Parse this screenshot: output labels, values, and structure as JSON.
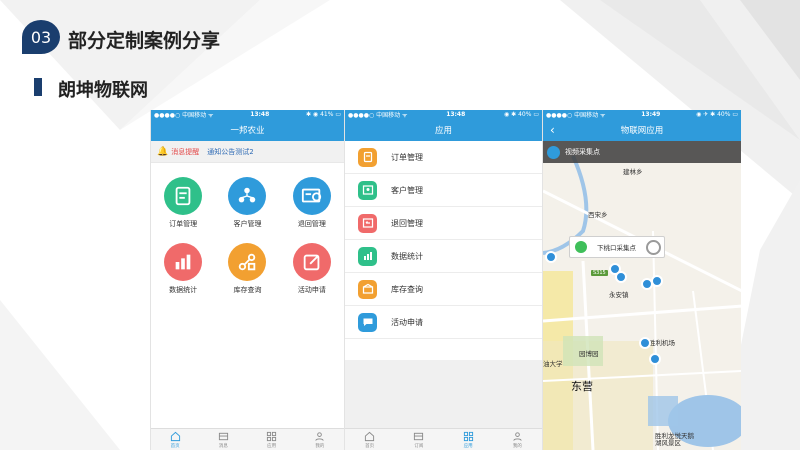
{
  "slide": {
    "section_number": "03",
    "section_title": "部分定制案例分享",
    "subtitle": "朗坤物联网"
  },
  "phone1": {
    "status": {
      "carrier": "●●●●○ 中国移动 ᯤ",
      "time": "13:48",
      "battery": "✱ ◉ 41% ▭"
    },
    "title": "一邦农业",
    "notice": {
      "label": "消息提醒",
      "text": "通知公告测试2"
    },
    "grid": [
      {
        "label": "订单管理",
        "icon": "order-icon",
        "color": "#2fc08a"
      },
      {
        "label": "客户管理",
        "icon": "customer-icon",
        "color": "#2f9bdb"
      },
      {
        "label": "退回管理",
        "icon": "return-icon",
        "color": "#2f9bdb"
      },
      {
        "label": "数据统计",
        "icon": "chart-icon",
        "color": "#f06a6a"
      },
      {
        "label": "库存查询",
        "icon": "inventory-icon",
        "color": "#f2a031"
      },
      {
        "label": "活动申请",
        "icon": "edit-icon",
        "color": "#f06a6a"
      }
    ],
    "tabs": [
      {
        "label": "首页",
        "icon": "home-icon",
        "active": true
      },
      {
        "label": "消息",
        "icon": "message-icon",
        "active": false
      },
      {
        "label": "应用",
        "icon": "apps-icon",
        "active": false
      },
      {
        "label": "我的",
        "icon": "user-icon",
        "active": false
      }
    ]
  },
  "phone2": {
    "status": {
      "carrier": "●●●●○ 中国移动 ᯤ",
      "time": "13:48",
      "battery": "◉ ✱ 40% ▭"
    },
    "title": "应用",
    "menu": [
      {
        "label": "订单管理",
        "icon": "order-icon",
        "color": "#f2a031"
      },
      {
        "label": "客户管理",
        "icon": "customer-icon",
        "color": "#2fc08a"
      },
      {
        "label": "退回管理",
        "icon": "return-icon",
        "color": "#f06a6a"
      },
      {
        "label": "数据统计",
        "icon": "chart-icon",
        "color": "#2fc08a"
      },
      {
        "label": "库存查询",
        "icon": "inventory-icon",
        "color": "#f2a031"
      },
      {
        "label": "活动申请",
        "icon": "chat-icon",
        "color": "#2f9bdb"
      }
    ],
    "tabs": [
      {
        "label": "首页",
        "icon": "home-icon",
        "active": false
      },
      {
        "label": "订阅",
        "icon": "message-icon",
        "active": false
      },
      {
        "label": "应用",
        "icon": "apps-icon",
        "active": true
      },
      {
        "label": "我的",
        "icon": "user-icon",
        "active": false
      }
    ]
  },
  "phone3": {
    "status": {
      "carrier": "●●●●○ 中国移动 ᯤ",
      "time": "13:49",
      "battery": "◉ ✈ ✱ 40% ▭"
    },
    "title": "物联网应用",
    "camera_bar": "视频采集点",
    "popup": "下桃口采集点",
    "road": "S315",
    "places": [
      "建林乡",
      "西宋乡",
      "永安镇",
      "胜利机场",
      "园博园",
      "油大学",
      "东营",
      "胜利龙悦天鹅湖风景区"
    ]
  }
}
